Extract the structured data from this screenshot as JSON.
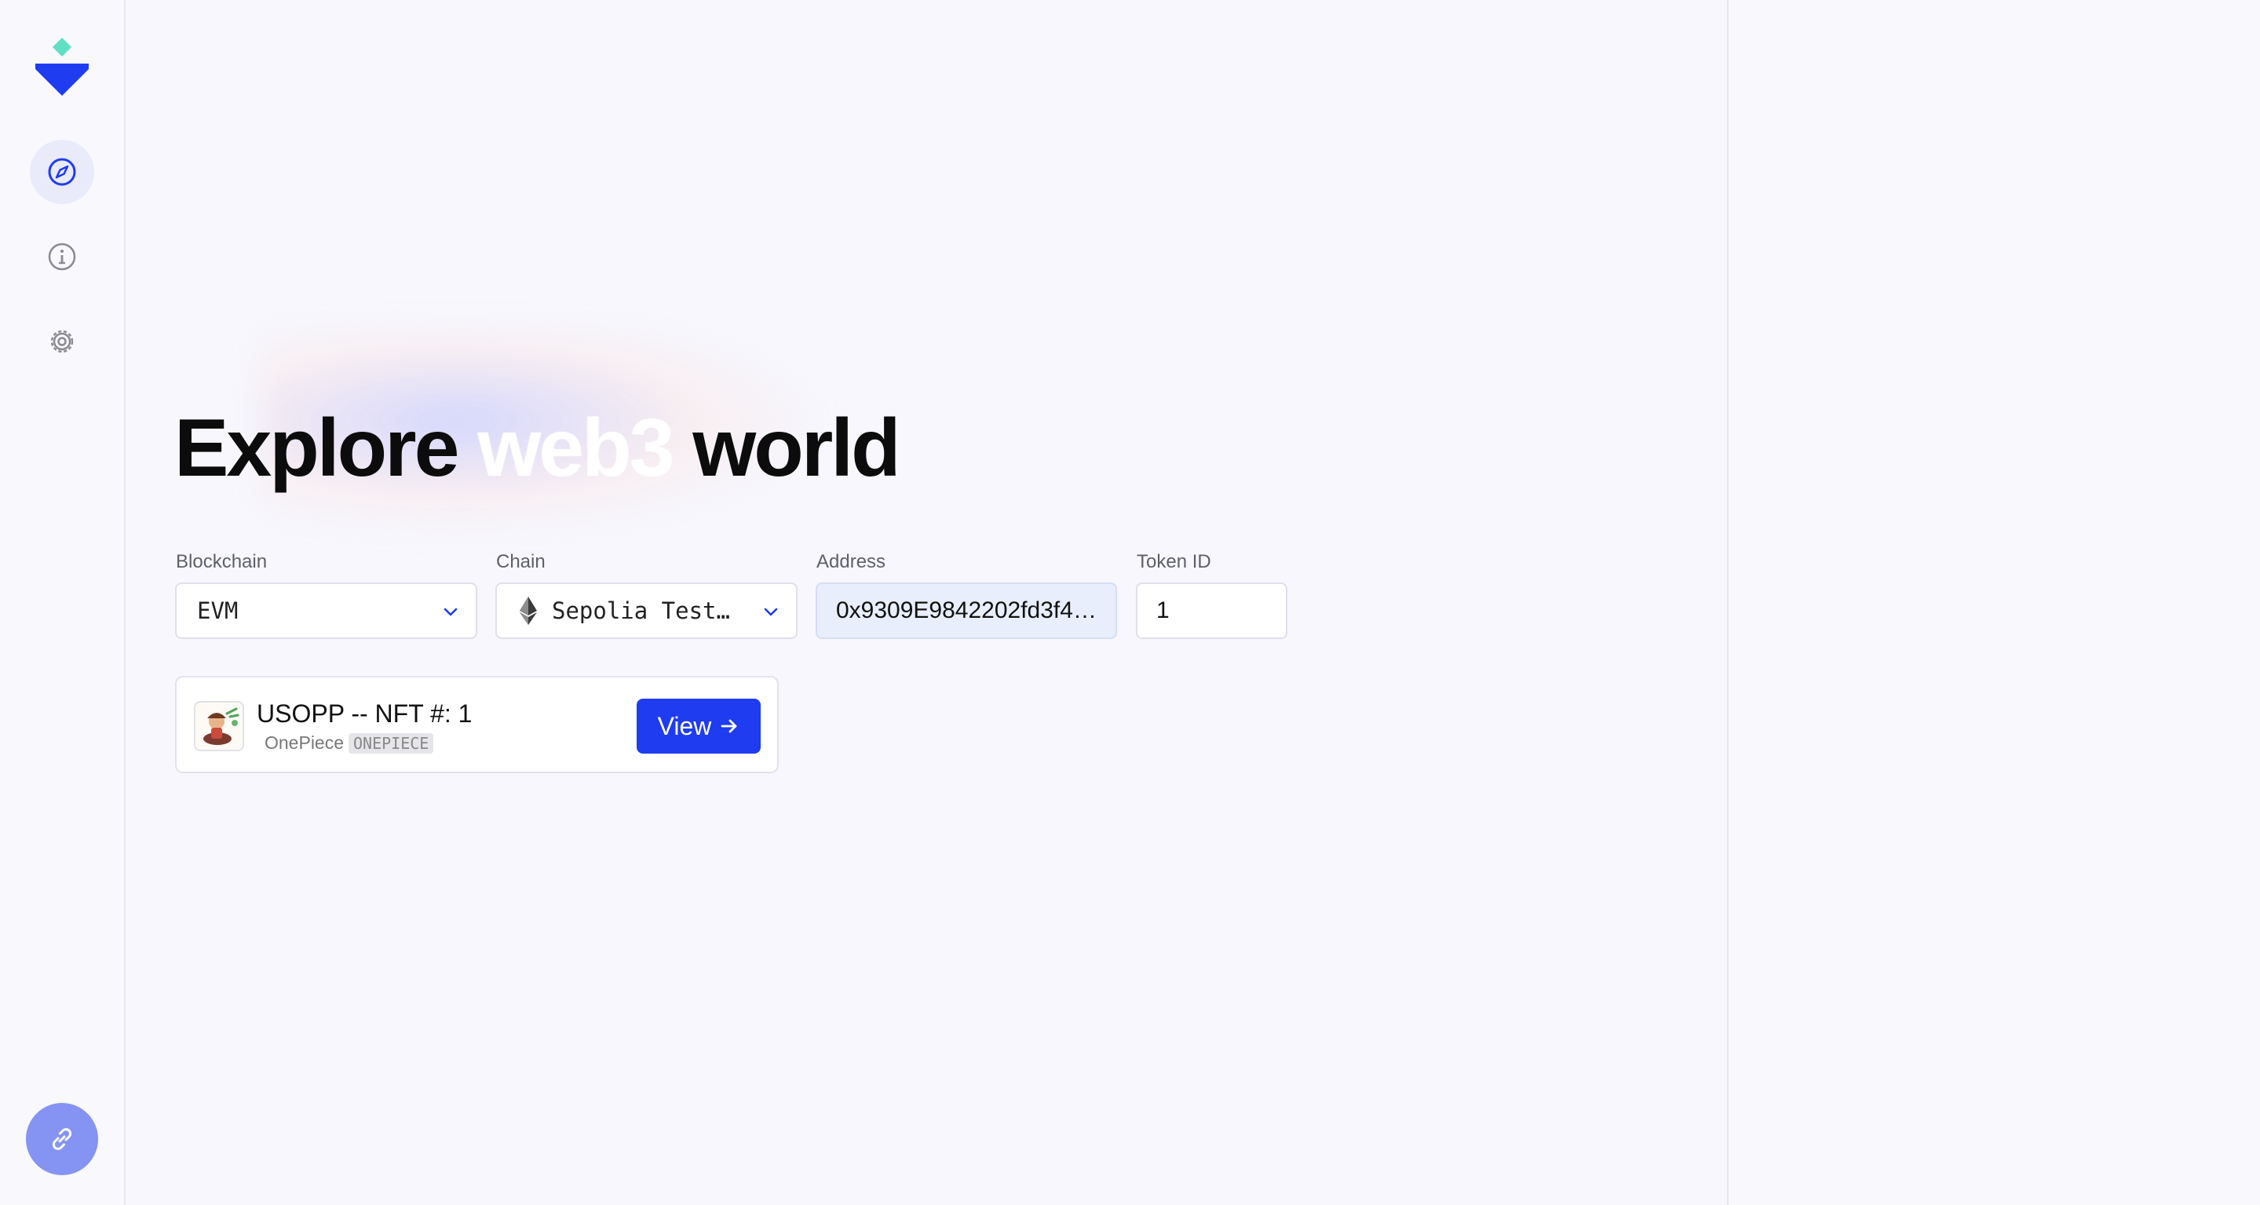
{
  "hero": {
    "prefix": "Explore",
    "accent": "web3",
    "suffix": "world"
  },
  "sidebar": {
    "items": [
      {
        "name": "compass-icon",
        "active": true
      },
      {
        "name": "info-icon",
        "active": false
      },
      {
        "name": "gear-icon",
        "active": false
      }
    ],
    "connect_icon": "link-icon"
  },
  "form": {
    "blockchain": {
      "label": "Blockchain",
      "value": "EVM"
    },
    "chain": {
      "label": "Chain",
      "value": "Sepolia Test…",
      "icon": "ethereum-icon"
    },
    "address": {
      "label": "Address",
      "value": "0x9309E9842202fd3f4…"
    },
    "token_id": {
      "label": "Token ID",
      "value": "1"
    }
  },
  "result": {
    "title": "USOPP -- NFT #: 1",
    "collection": "OnePiece",
    "symbol": "ONEPIECE",
    "button_label": "View"
  },
  "colors": {
    "accent": "#1f3cf0",
    "background": "#f7f7fd",
    "connect_button": "#8593f2",
    "logo_top": "#5fe0c3",
    "logo_bottom": "#1f3cf0"
  }
}
